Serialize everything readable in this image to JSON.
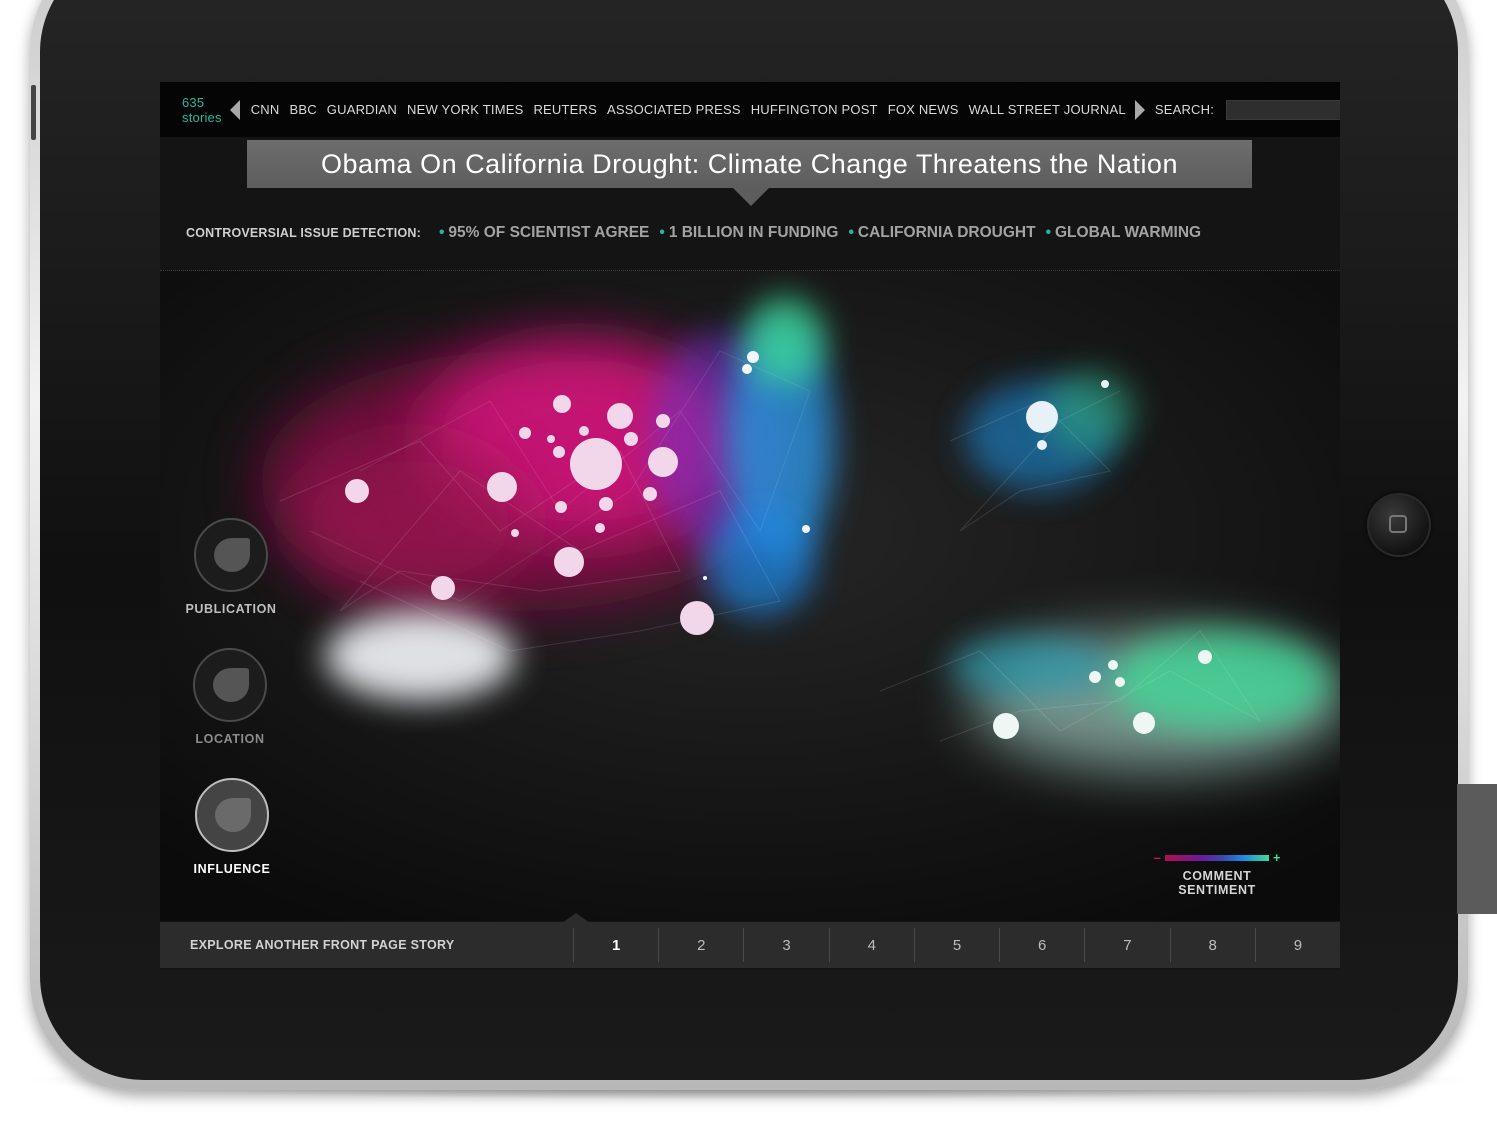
{
  "topbar": {
    "story_count": "635 stories",
    "sources": [
      "CNN",
      "BBC",
      "GUARDIAN",
      "NEW YORK TIMES",
      "REUTERS",
      "ASSOCIATED PRESS",
      "HUFFINGTON POST",
      "FOX NEWS",
      "WALL STREET JOURNAL"
    ],
    "search_label": "SEARCH:",
    "search_value": ""
  },
  "headline": "Obama On California Drought: Climate Change Threatens the Nation",
  "issues": {
    "label": "CONTROVERSIAL ISSUE DETECTION:",
    "tags": [
      "95% OF SCIENTIST AGREE",
      "1 BILLION IN FUNDING",
      "CALIFORNIA  DROUGHT",
      "GLOBAL WARMING"
    ]
  },
  "filters": [
    {
      "label": "PUBLICATION",
      "active": false
    },
    {
      "label": "LOCATION",
      "active": false
    },
    {
      "label": "INFLUENCE",
      "active": true
    }
  ],
  "legend": {
    "minus": "–",
    "plus": "+",
    "label": "COMMENT SENTIMENT",
    "colors": [
      "#b0104f",
      "#6a1b9a",
      "#3949ab",
      "#1e88e5",
      "#3ddc97"
    ]
  },
  "bottom": {
    "explore_label": "EXPLORE ANOTHER FRONT PAGE STORY",
    "pages": [
      "1",
      "2",
      "3",
      "4",
      "5",
      "6",
      "7",
      "8",
      "9"
    ],
    "active_page": "1"
  },
  "colors": {
    "accent": "#27b6a4",
    "negative": "#e0188a",
    "neutral": "#2a8fd6",
    "positive": "#3ddc97"
  }
}
